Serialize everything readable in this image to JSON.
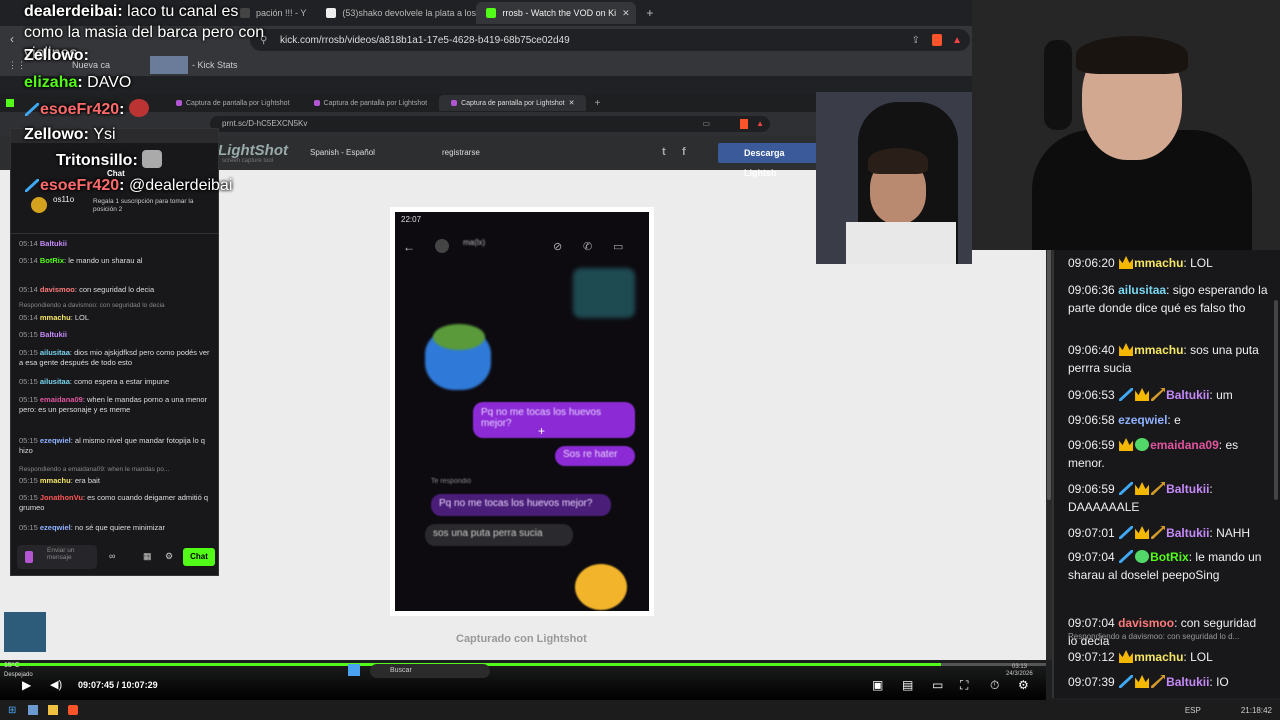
{
  "browser": {
    "tabs": [
      {
        "label": "Kick Stats",
        "icon": "kick-icon"
      },
      {
        "label": "pación !!! - Y",
        "icon": "youtube-icon"
      },
      {
        "label": "(53)shako devolvele la plata a los pib",
        "icon": "tiktok-icon"
      },
      {
        "label": "rrosb - Watch the VOD on Ki",
        "icon": "kick-icon"
      }
    ],
    "url": "kick.com/rrosb/videos/a818b1a1-17e5-4628-b419-68b75ce02d49",
    "bookmarks": [
      "Nueva ca",
      "Kick Stats"
    ]
  },
  "overlay_chat": [
    {
      "user": "dealerdeibai",
      "text": "laco tu canal es como la masia del barca pero con violines",
      "color": "#ffffff"
    },
    {
      "user": "Zellowo",
      "text": "",
      "color": "#ffffff"
    },
    {
      "user": "elizaha",
      "text": "DAVO",
      "color": "#53fc18"
    },
    {
      "user": "esoeFr420",
      "text": "",
      "color": "#ff6b6b"
    },
    {
      "user": "Zellowo",
      "text": "Ysi",
      "color": "#ffffff"
    },
    {
      "user": "Tritonsillo",
      "text": "",
      "color": "#ffffff"
    },
    {
      "user": "esoeFr420",
      "text": "@dealerdeibai",
      "color": "#ff6b6b"
    }
  ],
  "inner_browser": {
    "tabs": [
      "Captura de pantalla por Lightshot",
      "Captura de pantalla por Lightshot",
      "Captura de pantalla por Lightshot"
    ],
    "url": "prnt.sc/D-hC5EXCN5Kv"
  },
  "lightshot": {
    "logo": "LightShot",
    "tagline": "screen capture tool",
    "language": "Spanish - Español",
    "register": "registrarse",
    "download": "Descarga Lightsh",
    "caption": "Capturado con Lightshot"
  },
  "phone": {
    "time": "22:07",
    "contact": "ma(lx)",
    "messages": [
      {
        "text": "Pq no me tocas los huevos mejor?",
        "side": "right"
      },
      {
        "text": "Sos re hater",
        "side": "right"
      },
      {
        "text": "Te respondió",
        "side": "label"
      },
      {
        "text": "Pq no me tocas los huevos mejor?",
        "side": "quote"
      },
      {
        "text": "sos una puta perra sucia",
        "side": "left"
      }
    ]
  },
  "small_chat": {
    "title": "Chat",
    "sub_user": "os11o",
    "sub_text": "Regala 1 suscripción para tomar la posición 2",
    "lines": [
      {
        "time": "05:14",
        "user": "Baltukii",
        "text": "",
        "color": "#c58af9"
      },
      {
        "time": "05:14",
        "user": "BotRix",
        "text": "le mando un sharau al",
        "color": "#53fc18"
      },
      {
        "time": "05:14",
        "user": "davismoo",
        "text": "con seguridad lo decia",
        "color": "#ff7a7a"
      },
      {
        "time": "",
        "user": "",
        "text": "Respondiendo a davismoo: con seguridad lo decia",
        "color": "#888"
      },
      {
        "time": "05:14",
        "user": "mmachu",
        "text": "LOL",
        "color": "#f5e663"
      },
      {
        "time": "05:15",
        "user": "Baltukii",
        "text": "",
        "color": "#c58af9"
      },
      {
        "time": "05:15",
        "user": "ailusitaa",
        "text": "dios mio ajskjdfksd pero como podés ver a esa gente después de todo esto",
        "color": "#7ad7f0"
      },
      {
        "time": "05:15",
        "user": "ailusitaa",
        "text": "como espera a estar impune",
        "color": "#7ad7f0"
      },
      {
        "time": "05:15",
        "user": "emaidana09",
        "text": "when le mandas porno a una menor pero: es un personaje y es meme",
        "color": "#e0559e"
      },
      {
        "time": "05:15",
        "user": "ezeqwiel",
        "text": "al mismo nivel que mandar fotopija lo q hizo",
        "color": "#8fb1ff"
      },
      {
        "time": "",
        "user": "",
        "text": "Respondiendo a emaidana09: when le mandas po...",
        "color": "#888"
      },
      {
        "time": "05:15",
        "user": "mmachu",
        "text": "era bait",
        "color": "#f5e663"
      },
      {
        "time": "05:15",
        "user": "JonathonVu",
        "text": "es como cuando deigamer admitió q grumeo",
        "color": "#ff5555"
      },
      {
        "time": "05:15",
        "user": "ezeqwiel",
        "text": "no sé que quiere minimizar",
        "color": "#8fb1ff"
      }
    ],
    "input_placeholder": "Enviar un mensaje",
    "send": "Chat"
  },
  "right_chat": [
    {
      "time": "09:06:20",
      "badges": [
        "crown"
      ],
      "user": "mmachu",
      "color": "#f5e663",
      "text": "LOL"
    },
    {
      "time": "09:06:36",
      "badges": [],
      "user": "ailusitaa",
      "color": "#7ad7f0",
      "text": "sigo esperando la parte donde dice qué es falso tho"
    },
    {
      "time": "09:06:40",
      "badges": [
        "crown"
      ],
      "user": "mmachu",
      "color": "#f5e663",
      "text": "sos una puta perrra sucia"
    },
    {
      "time": "09:06:53",
      "badges": [
        "sword",
        "crown",
        "pick"
      ],
      "user": "Baltukii",
      "color": "#c58af9",
      "text": "um"
    },
    {
      "time": "09:06:58",
      "badges": [],
      "user": "ezeqwiel",
      "color": "#8fb1ff",
      "text": "e"
    },
    {
      "time": "09:06:59",
      "badges": [
        "crown",
        "verified"
      ],
      "user": "emaidana09",
      "color": "#e0559e",
      "text": "es menor."
    },
    {
      "time": "09:06:59",
      "badges": [
        "sword",
        "crown",
        "pick"
      ],
      "user": "Baltukii",
      "color": "#c58af9",
      "text": "DAAAAAALE"
    },
    {
      "time": "09:07:01",
      "badges": [
        "sword",
        "crown",
        "pick"
      ],
      "user": "Baltukii",
      "color": "#c58af9",
      "text": "NAHH"
    },
    {
      "time": "09:07:04",
      "badges": [
        "sword",
        "verified"
      ],
      "user": "BotRix",
      "color": "#53fc18",
      "text": "le mando un sharau al doselel peepoSing"
    },
    {
      "time": "09:07:04",
      "badges": [],
      "user": "davismoo",
      "color": "#ff7a7a",
      "text": "con seguridad lo decia"
    },
    {
      "time": "09:07:12",
      "badges": [
        "crown"
      ],
      "user": "mmachu",
      "color": "#f5e663",
      "text": "LOL",
      "reply": "Respondiendo a davismoo: con seguridad lo d..."
    },
    {
      "time": "09:07:39",
      "badges": [
        "sword",
        "crown",
        "pick"
      ],
      "user": "Baltukii",
      "color": "#c58af9",
      "text": "IO"
    }
  ],
  "player": {
    "current": "09:07:45",
    "total": "10:07:29",
    "progress": 0.9,
    "weather_temp": "15°C",
    "weather_text": "Despejado",
    "search": "Buscar",
    "clock_small": "03:13",
    "date_small": "24/3/2026",
    "lang": "ESP",
    "clock": "21:18:42"
  },
  "colors": {
    "kick_green": "#53fc18",
    "bubble_purple": "#8c2bd6",
    "badge_crown": "#f5b800",
    "badge_sword": "#3fa9f5"
  }
}
